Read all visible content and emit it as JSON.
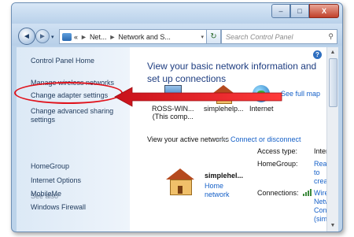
{
  "window": {
    "buttons": {
      "minimize": "–",
      "maximize": "□",
      "close": "X"
    }
  },
  "navbar": {
    "back_glyph": "◄",
    "forward_glyph": "►",
    "dropdown_glyph": "▾",
    "breadcrumb": [
      "Net...",
      "Network and S..."
    ],
    "breadcrumb_prefix": "«",
    "breadcrumb_sep": "►",
    "refresh_glyph": "↻",
    "search_placeholder": "Search Control Panel",
    "search_glyph": "⚲"
  },
  "sidebar": {
    "home": "Control Panel Home",
    "tasks": [
      "Manage wireless networks",
      "Change adapter settings",
      "Change advanced sharing",
      "settings"
    ],
    "see_also_label": "See also",
    "see_also": [
      "HomeGroup",
      "Internet Options",
      "MobileMe",
      "Windows Firewall"
    ]
  },
  "main": {
    "help_glyph": "?",
    "heading_line1": "View your basic network information and",
    "heading_line2": "set up connections",
    "see_full_map": "See full map",
    "nodes": [
      {
        "line1": "ROSS-WIN...",
        "line2": "(This comp..."
      },
      {
        "line1": "simplehelp...",
        "line2": ""
      },
      {
        "line1": "Internet",
        "line2": ""
      }
    ],
    "active_networks_label": "View your active networks",
    "connect_disconnect": "Connect or disconnect",
    "network": {
      "name": "simplehel...",
      "type_line1": "Home",
      "type_line2": "network",
      "access_type_label": "Access type:",
      "access_type_value": "Interr",
      "homegroup_label": "HomeGroup:",
      "homegroup_value": [
        "Ready",
        "to",
        "create"
      ],
      "connections_label": "Connections:",
      "connections_value": [
        "Wirel",
        "Netw",
        "Conn",
        "(simp"
      ]
    }
  },
  "scrollbar": {
    "up": "▲",
    "down": "▼"
  },
  "colors": {
    "annotation": "#e0121b",
    "link": "#1560c8",
    "heading": "#1e3d80"
  }
}
